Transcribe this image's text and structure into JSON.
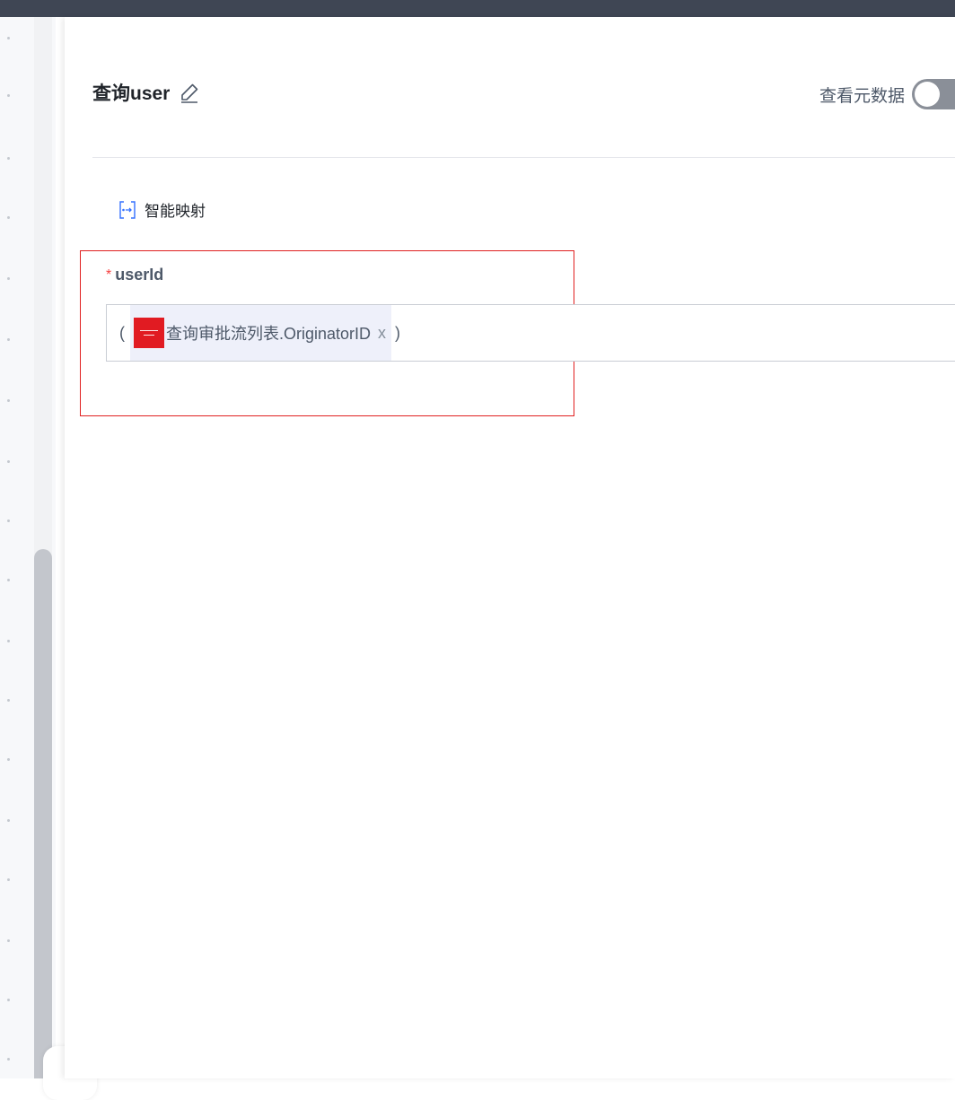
{
  "header": {
    "title": "查询user",
    "metadata_toggle_label": "查看元数据"
  },
  "toolbar": {
    "smart_mapping_label": "智能映射"
  },
  "field": {
    "required_mark": "*",
    "label": "userId",
    "expression": {
      "open_paren": "(",
      "chip_text": "查询审批流列表.OriginatorID",
      "chip_remove": "x",
      "close_paren": ")"
    }
  },
  "colors": {
    "topbar": "#3f4654",
    "highlight_border": "#e02020",
    "required": "#f53f3f",
    "chip_background": "#eef0fa",
    "chip_logo": "#e11b22",
    "accent_icon": "#3370ff"
  },
  "icons": {
    "edit": "pencil-icon",
    "smart_mapping": "mapping-icon",
    "chip_source": "app-logo-icon"
  }
}
